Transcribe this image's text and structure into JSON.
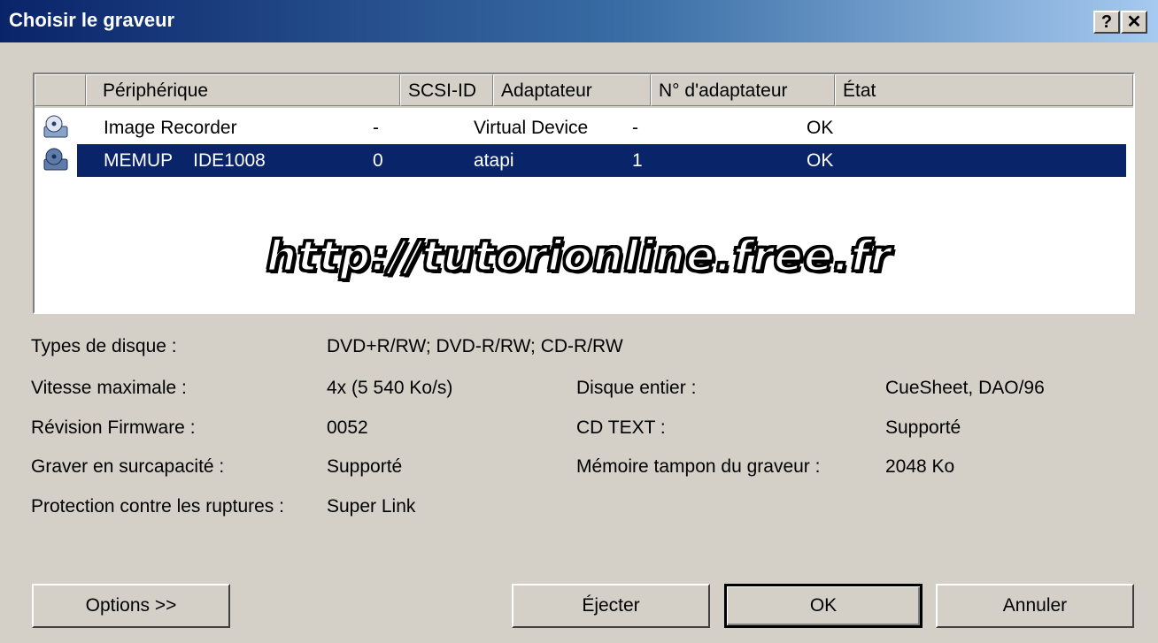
{
  "window": {
    "title": "Choisir le graveur",
    "help_label": "?",
    "close_label": "✕"
  },
  "list": {
    "columns": [
      "Périphérique",
      "SCSI-ID",
      "Adaptateur",
      "N° d'adaptateur",
      "État"
    ],
    "rows": [
      {
        "device": "Image Recorder",
        "scsi_id": "-",
        "adapter": "Virtual Device",
        "adapter_no": "-",
        "state": "OK",
        "selected": false
      },
      {
        "device": "MEMUP    IDE1008",
        "scsi_id": "0",
        "adapter": "atapi",
        "adapter_no": "1",
        "state": "OK",
        "selected": true
      }
    ]
  },
  "watermark": "http://tutorionline.free.fr",
  "info": {
    "disc_types_label": "Types de disque :",
    "disc_types_value": "DVD+R/RW; DVD-R/RW; CD-R/RW",
    "max_speed_label": "Vitesse maximale :",
    "max_speed_value": "4x (5 540 Ko/s)",
    "whole_disc_label": "Disque entier :",
    "whole_disc_value": "CueSheet, DAO/96",
    "firmware_label": "Révision Firmware :",
    "firmware_value": "0052",
    "cd_text_label": "CD TEXT :",
    "cd_text_value": "Supporté",
    "overburn_label": "Graver en surcapacité :",
    "overburn_value": "Supporté",
    "buffer_label": "Mémoire tampon du graveur :",
    "buffer_value": "2048 Ko",
    "underrun_label": "Protection contre les ruptures :",
    "underrun_value": "Super Link"
  },
  "buttons": {
    "options": "Options >>",
    "eject": "Éjecter",
    "ok": "OK",
    "cancel": "Annuler"
  }
}
